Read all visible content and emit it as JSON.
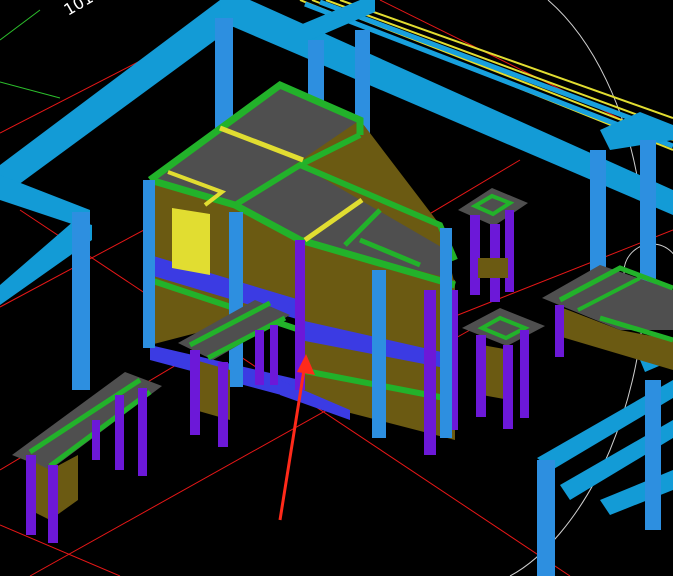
{
  "viewport": {
    "background": "#000000",
    "grid_label": "101",
    "colors": {
      "beam": "#139bd6",
      "column_blue": "#2d8fe0",
      "slab_top": "#4f4f4f",
      "wall_side": "#6b5a12",
      "green_edge": "#22b22a",
      "yellow_line": "#e1dd31",
      "rebar_purple": "#6c18d8",
      "blue_band": "#3b3be3",
      "axis_red": "#ff1a1a",
      "arrow_red": "#ff2a1a",
      "axis_green": "#2cbf2c",
      "circle_gray": "#cfcfcf"
    }
  }
}
